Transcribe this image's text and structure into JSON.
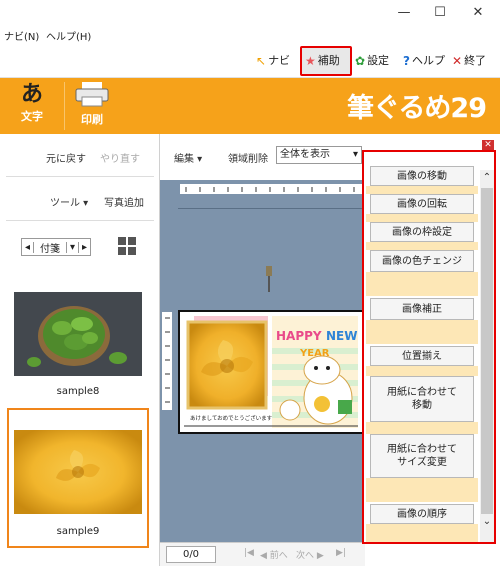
{
  "window": {
    "minimize": "—",
    "maximize": "☐",
    "close": "✕"
  },
  "menubar": {
    "items": [
      "ナビ(N)",
      "ヘルプ(H)"
    ]
  },
  "toolbar": {
    "navi": "ナビ",
    "hojo": "補助",
    "settei": "設定",
    "help": "ヘルプ",
    "exit": "終了"
  },
  "banner": {
    "tab_moji_icon": "あ",
    "tab_moji": "文字",
    "tab_print": "印刷",
    "brand": "筆ぐるめ29"
  },
  "left_panel": {
    "undo": "元に戻す",
    "redo": "やり直す",
    "tool": "ツール",
    "add_photo": "写真追加",
    "pager_label": "付箋",
    "thumbnails": [
      {
        "label": "sample8"
      },
      {
        "label": "sample9"
      }
    ]
  },
  "center": {
    "edit": "編集",
    "area_delete": "領域削除",
    "zoom": "全体を表示",
    "page": "0/0",
    "nav_first": "|◀",
    "nav_prev": "◀ 前へ",
    "nav_next": "次へ ▶",
    "nav_last": "▶|"
  },
  "card": {
    "happy": "HAPPY",
    "new": "NEW",
    "year": "YEAR",
    "message": "あけましておめでとうございます"
  },
  "right_panel": {
    "close": "✕",
    "buttons": [
      "画像の移動",
      "画像の回転",
      "画像の枠設定",
      "画像の色チェンジ",
      "画像補正",
      "位置揃え",
      "用紙に合わせて\n移動",
      "用紙に合わせて\nサイズ変更",
      "画像の順序"
    ]
  },
  "colors": {
    "accent_orange": "#f6a21a",
    "highlight_red": "#e60000",
    "selection_orange": "#f0851a",
    "canvas_bg": "#7d93ab",
    "panel_stripe": "#fde7b6"
  }
}
